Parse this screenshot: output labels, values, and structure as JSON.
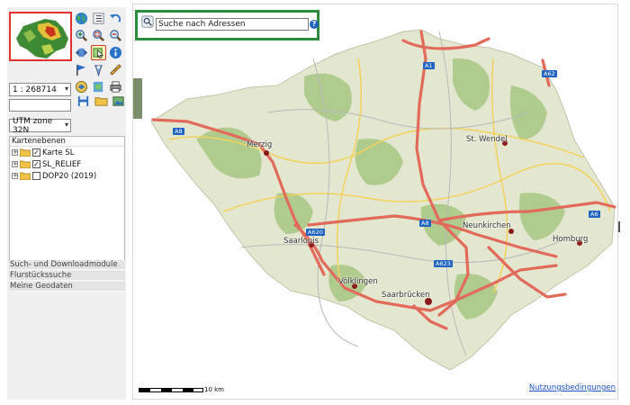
{
  "toolbar": {
    "icons": [
      "globe-icon",
      "layer-list-icon",
      "undo-icon",
      "zoom-in-icon",
      "zoom-box-icon",
      "zoom-out-icon",
      "pan-icon",
      "select-feature-icon",
      "info-icon",
      "flag-icon",
      "pin-icon",
      "ruler-icon",
      "layers-icon",
      "pdf-icon",
      "print-icon"
    ]
  },
  "scale": {
    "value": "1 : 268714"
  },
  "coordinates": {
    "value": ""
  },
  "crs": {
    "value": "UTM zone 32N"
  },
  "layers": {
    "title": "Kartenebenen",
    "items": [
      {
        "label": "Karte SL",
        "checked": true
      },
      {
        "label": "SL_RELIEF",
        "checked": true
      },
      {
        "label": "DOP20 (2019)",
        "checked": false
      }
    ]
  },
  "accordion": [
    "Such- und Downloadmodule",
    "Flurstückssuche",
    "Meine Geodaten"
  ],
  "search": {
    "placeholder": "Suche nach Adressen",
    "value": "Suche nach Adressen"
  },
  "map": {
    "scalebar_label": "10 km",
    "terms_link": "Nutzungsbedingungen",
    "cities": [
      "Merzig",
      "St. Wendel",
      "Neunkirchen",
      "Homburg",
      "Saarlouis",
      "Völklingen",
      "Saarbrücken"
    ],
    "highways": [
      "A8",
      "A1",
      "A62",
      "A620",
      "A623",
      "A6",
      "A8"
    ],
    "colors": {
      "region_fill": "#e4e7d0",
      "forest": "#a7c583",
      "highway": "#e26a5a",
      "secondary_road": "#f2d25a"
    }
  }
}
